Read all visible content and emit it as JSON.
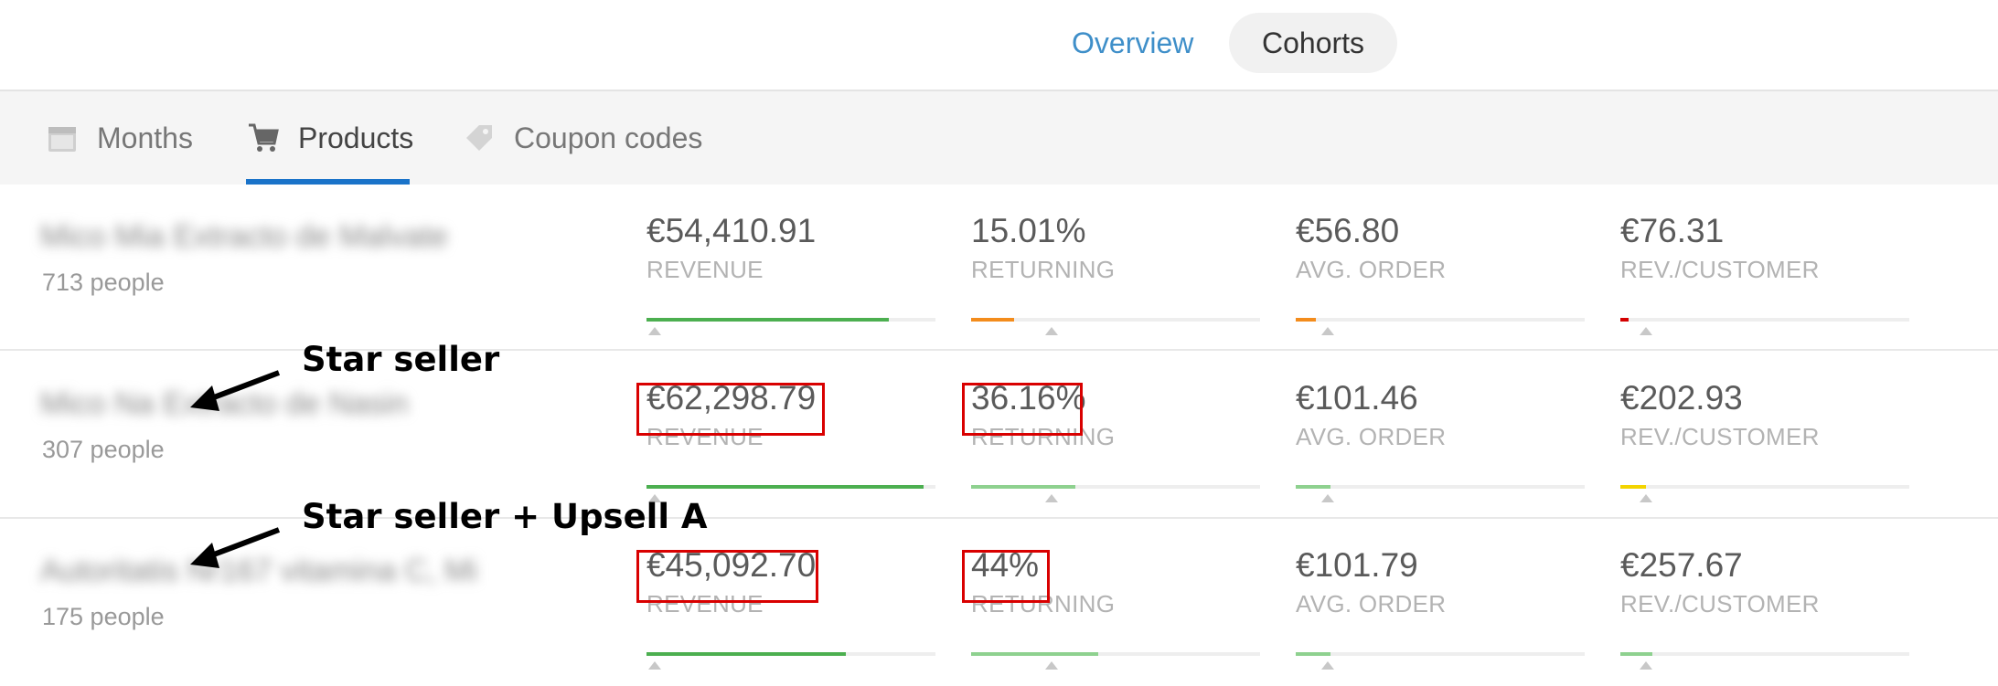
{
  "top_tabs": [
    {
      "label": "Overview",
      "active": false
    },
    {
      "label": "Cohorts",
      "active": true
    }
  ],
  "sub_tabs": [
    {
      "label": "Months",
      "icon": "calendar-icon",
      "active": false
    },
    {
      "label": "Products",
      "icon": "cart-icon",
      "active": true
    },
    {
      "label": "Coupon codes",
      "icon": "tag-icon",
      "active": false
    }
  ],
  "colors": {
    "accent": "#1a73c9",
    "link": "#3f8fc9",
    "green": "#4caf50",
    "light_green": "#8ed18f",
    "orange": "#f38c1c",
    "red": "#d40000",
    "yellow": "#f3d400",
    "highlight_box": "#d90000"
  },
  "rows": [
    {
      "name": "Mico Mia Extracto de Malvate",
      "people": "713 people",
      "metrics": [
        {
          "value": "€54,410.91",
          "label": "REVENUE",
          "fill_pct": 84,
          "marker_pct": 3,
          "color": "#4caf50"
        },
        {
          "value": "15.01%",
          "label": "RETURNING",
          "fill_pct": 15,
          "marker_pct": 28,
          "color": "#f38c1c"
        },
        {
          "value": "€56.80",
          "label": "AVG. ORDER",
          "fill_pct": 7,
          "marker_pct": 11,
          "color": "#f38c1c"
        },
        {
          "value": "€76.31",
          "label": "REV./CUSTOMER",
          "fill_pct": 3,
          "marker_pct": 9,
          "color": "#d40000"
        }
      ]
    },
    {
      "name": "Mico Na Extracto de Nasin",
      "people": "307 people",
      "annotation": "Star seller",
      "metrics": [
        {
          "value": "€62,298.79",
          "label": "REVENUE",
          "fill_pct": 96,
          "marker_pct": 3,
          "color": "#4caf50",
          "highlighted": true
        },
        {
          "value": "36.16%",
          "label": "RETURNING",
          "fill_pct": 36,
          "marker_pct": 28,
          "color": "#8ed18f",
          "highlighted": true
        },
        {
          "value": "€101.46",
          "label": "AVG. ORDER",
          "fill_pct": 12,
          "marker_pct": 11,
          "color": "#8ed18f"
        },
        {
          "value": "€202.93",
          "label": "REV./CUSTOMER",
          "fill_pct": 9,
          "marker_pct": 9,
          "color": "#f3d400"
        }
      ]
    },
    {
      "name": "Autoritatis Nr167 vitamina C, Mi...",
      "people": "175 people",
      "annotation": "Star seller + Upsell A",
      "metrics": [
        {
          "value": "€45,092.70",
          "label": "REVENUE",
          "fill_pct": 69,
          "marker_pct": 3,
          "color": "#4caf50",
          "highlighted": true
        },
        {
          "value": "44%",
          "label": "RETURNING",
          "fill_pct": 44,
          "marker_pct": 28,
          "color": "#8ed18f",
          "highlighted": true
        },
        {
          "value": "€101.79",
          "label": "AVG. ORDER",
          "fill_pct": 12,
          "marker_pct": 11,
          "color": "#8ed18f"
        },
        {
          "value": "€257.67",
          "label": "REV./CUSTOMER",
          "fill_pct": 11,
          "marker_pct": 9,
          "color": "#8ed18f"
        }
      ]
    }
  ]
}
